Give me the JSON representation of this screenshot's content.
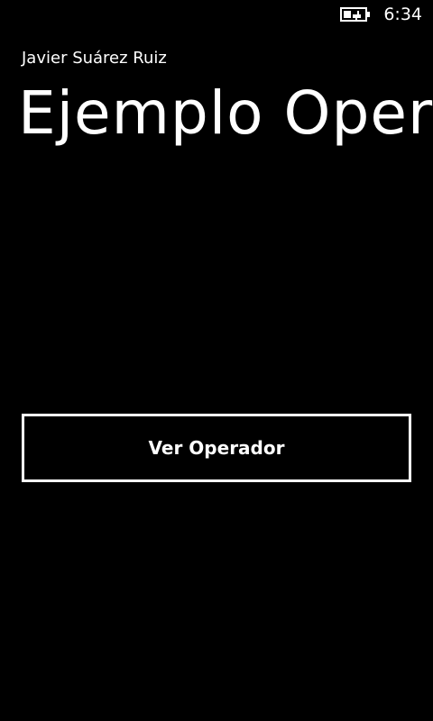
{
  "status_bar": {
    "battery_icon": "battery-charging-icon",
    "time": "6:34"
  },
  "header": {
    "app_name": "Javier Suárez Ruiz",
    "page_title": "Ejemplo Operador"
  },
  "main": {
    "button_label": "Ver Operador"
  },
  "colors": {
    "background": "#000000",
    "foreground": "#ffffff"
  }
}
